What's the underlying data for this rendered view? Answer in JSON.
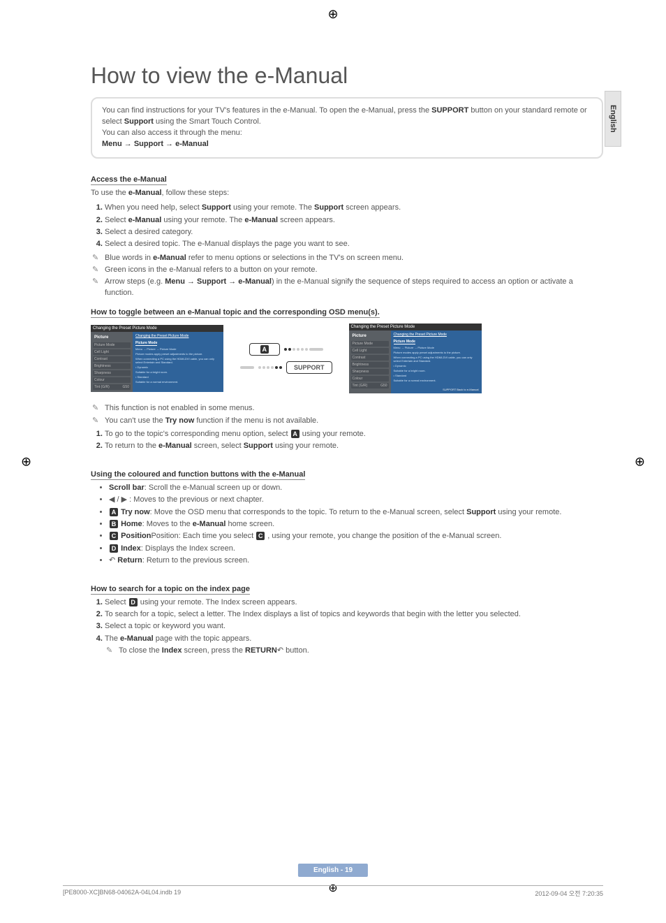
{
  "langTab": "English",
  "regMark": "⊕",
  "title": "How to view the e-Manual",
  "intro": {
    "line1_pre": "You can find instructions for your TV's features in the e-Manual. To open the e-Manual, press the ",
    "support": "SUPPORT",
    "line1_mid": " button on your standard remote or select ",
    "select_support": "Support",
    "line1_post": " using the Smart Touch Control.",
    "line2": "You can also access it through the menu:",
    "menuPath": "Menu → Support → e-Manual"
  },
  "accessTitle": "Access the e-Manual",
  "accessIntro": "To use the e-Manual, follow these steps:",
  "accessSteps": [
    "When you need help, select Support using your remote. The Support screen appears.",
    "Select e-Manual using your remote. The e-Manual screen appears.",
    "Select a desired category.",
    "Select a desired topic. The e-Manual displays the page you want to see."
  ],
  "accessNotes": [
    "Blue words in e-Manual refer to menu options or selections in the TV's on screen menu.",
    "Green icons in the e-Manual refers to a button on your remote.",
    "Arrow steps (e.g. Menu → Support → e-Manual) in the e-Manual signify the sequence of steps required to access an option or activate a function."
  ],
  "toggleTitle": "How to toggle between an e-Manual topic and the corresponding OSD menu(s).",
  "screenshot": {
    "header": "Changing the Preset Picture Mode",
    "sidebarTop": "Picture",
    "sidebarItems": [
      {
        "label": "Picture Mode",
        "value": ""
      },
      {
        "label": "Cell Light",
        "value": ""
      },
      {
        "label": "Contrast",
        "value": ""
      },
      {
        "label": "Brightness",
        "value": ""
      },
      {
        "label": "Sharpness",
        "value": ""
      },
      {
        "label": "Colour",
        "value": ""
      },
      {
        "label": "Tint (G/R)",
        "value": "G50"
      }
    ],
    "contentTitle": "Changing the Preset Picture Mode",
    "contentHeading": "Picture Mode",
    "contentSub1": "Menu → Picture → Picture Mode",
    "contentBody1": "Picture modes apply preset adjustments to the picture.",
    "contentBody2": "When connecting a PC using the HDMI-DVI cable, you can only select Entertain and Standard.",
    "contentItem1": "• Dynamic",
    "contentItem1b": "Suitable for a bright room.",
    "contentItem2": "• Standard",
    "contentItem2b": "Suitable for a normal environment.",
    "footer": "SUPPORT Back to e-Manual",
    "remoteA": "A",
    "remoteSupport": "SUPPORT"
  },
  "toggleNotes": [
    "This function is not enabled in some menus.",
    "You can't use the Try now function if the menu is not available."
  ],
  "toggleSteps": [
    "To go to the topic's corresponding menu option, select A using your remote.",
    "To return to the e-Manual screen, select Support using your remote."
  ],
  "colouredTitle": "Using the coloured and function buttons with the e-Manual",
  "colouredBullets": {
    "scroll": "Scroll bar: Scroll the e-Manual screen up or down.",
    "arrows": "◀ / ▶ : Moves to the previous or next chapter.",
    "tryNow": "Try now: Move the OSD menu that corresponds to the topic. To return to the e-Manual screen, select Support using your remote.",
    "home": "Home: Moves to the e-Manual home screen.",
    "position_pre": "Position: Each time you select ",
    "position_post": " , using your remote, you change the position of the e-Manual screen.",
    "index": "Index: Displays the Index screen.",
    "return": "Return: Return to the previous screen."
  },
  "searchTitle": "How to search for a topic on the index page",
  "searchSteps": [
    "Select D using your remote. The Index screen appears.",
    "To search for a topic, select a letter. The Index displays a list of topics and keywords that begin with the letter you selected.",
    "Select a topic or keyword you want.",
    "The e-Manual page with the topic appears."
  ],
  "searchNote": "To close the Index screen, press the RETURN↶ button.",
  "pageFooter": "English - 19",
  "fileFooter": {
    "left": "[PE8000-XC]BN68-04062A-04L04.indb   19",
    "right": "2012-09-04   오전 7:20:35"
  }
}
